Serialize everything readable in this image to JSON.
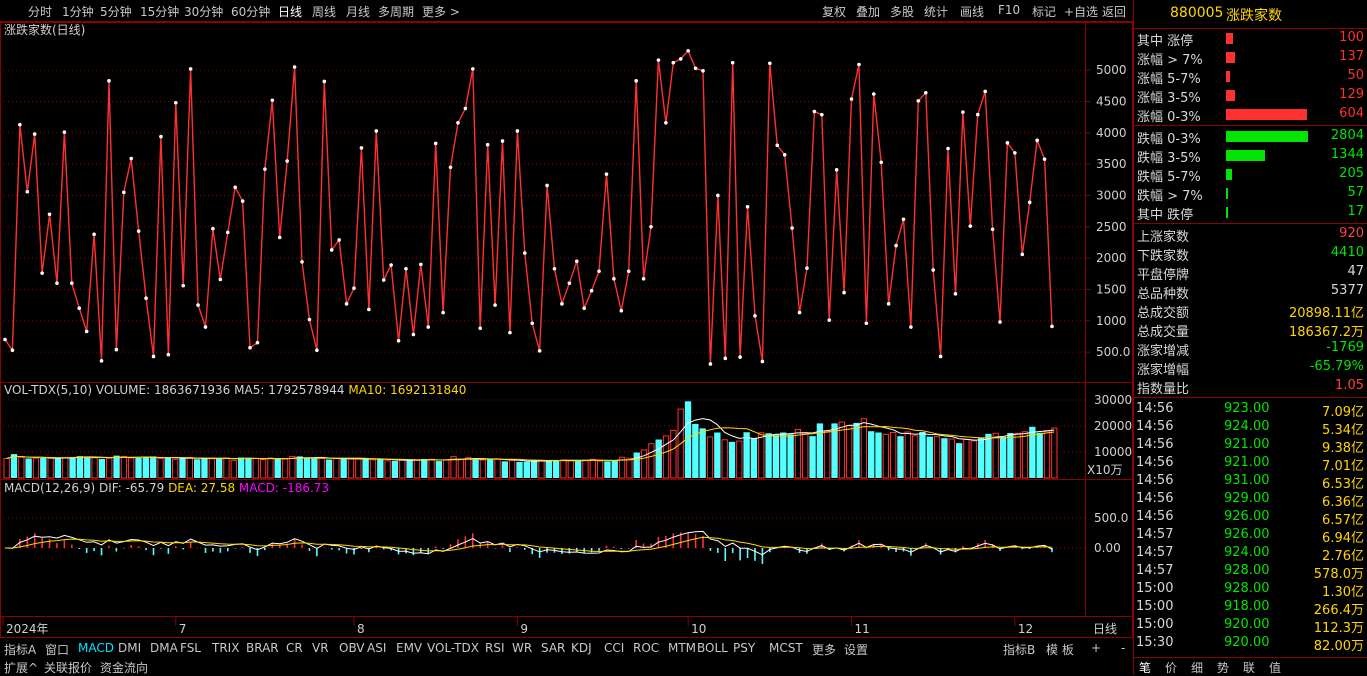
{
  "toolbar": {
    "periods": [
      "分时",
      "1分钟",
      "5分钟",
      "15分钟",
      "30分钟",
      "60分钟",
      "日线",
      "周线",
      "月线",
      "多周期",
      "更多"
    ],
    "active_period": "日线",
    "more_arrow": ">",
    "tools": [
      "复权",
      "叠加",
      "多股",
      "统计",
      "画线",
      "F10",
      "标记",
      "+自选",
      "返回"
    ]
  },
  "main_chart": {
    "title": "涨跌家数(日线)",
    "y_ticks": [
      "5000",
      "4500",
      "4000",
      "3500",
      "3000",
      "2500",
      "2000",
      "1500",
      "1000",
      "500.0"
    ],
    "line_color": "#ff3030"
  },
  "chart_data": [
    {
      "type": "line",
      "title": "涨跌家数(日线)",
      "ylim": [
        150,
        5450
      ],
      "series": [
        {
          "values": [
            700,
            530,
            4130,
            3060,
            3980,
            1760,
            2700,
            1600,
            4010,
            1600,
            1200,
            830,
            2380,
            360,
            4830,
            540,
            3050,
            3590,
            2430,
            1360,
            430,
            3940,
            460,
            4480,
            1560,
            5020,
            1250,
            900,
            2470,
            1660,
            2410,
            3130,
            2910,
            570,
            650,
            3420,
            4520,
            2330,
            3550,
            5050,
            1940,
            1020,
            530,
            4820,
            2130,
            2290,
            1270,
            1520,
            3760,
            1180,
            4030,
            1650,
            1890,
            680,
            1830,
            780,
            1900,
            900,
            3830,
            1130,
            3450,
            4160,
            4390,
            5020,
            880,
            3810,
            1250,
            3870,
            810,
            4030,
            2080,
            960,
            520,
            3160,
            1830,
            1270,
            1600,
            1950,
            1200,
            1480,
            1790,
            3340,
            1670,
            1160,
            1790,
            4830,
            1670,
            2500,
            5160,
            4160,
            5120,
            5180,
            5310,
            5030,
            4990,
            310,
            3000,
            400,
            5120,
            420,
            2820,
            1080,
            350,
            5110,
            3800,
            3650,
            2480,
            1130,
            1840,
            4340,
            4290,
            1010,
            3410,
            1450,
            4540,
            5090,
            960,
            4620,
            3530,
            1270,
            2200,
            2620,
            900,
            4510,
            4640,
            1810,
            430,
            3750,
            1430,
            4330,
            2510,
            4290,
            4660,
            2460,
            980,
            3840,
            3680,
            2060,
            2890,
            3880,
            3580,
            910
          ]
        }
      ]
    },
    {
      "type": "bar",
      "title": "VOL-TDX(5,10)",
      "ylabel": "X10万",
      "ylim": [
        0,
        30000
      ],
      "series": [
        {
          "name": "VOLUME",
          "value_label": "1863671936"
        },
        {
          "name": "MA5",
          "value_label": "1792578944"
        },
        {
          "name": "MA10",
          "value_label": "1692131840"
        }
      ],
      "values": [
        7500,
        9200,
        8000,
        7500,
        7600,
        7700,
        7600,
        7800,
        7700,
        8100,
        8400,
        8300,
        7800,
        7300,
        7600,
        8600,
        8300,
        7700,
        7700,
        8000,
        8300,
        7500,
        7900,
        7200,
        7600,
        7900,
        7200,
        7600,
        7400,
        7700,
        7700,
        6700,
        7900,
        7800,
        7500,
        7100,
        7600,
        7400,
        7300,
        8300,
        8300,
        7800,
        7600,
        7600,
        7100,
        7500,
        7600,
        7300,
        7300,
        7500,
        7000,
        7300,
        6600,
        6600,
        6900,
        7000,
        6900,
        7300,
        7200,
        6500,
        7000,
        8200,
        7200,
        7800,
        7300,
        6900,
        7500,
        7200,
        6400,
        6800,
        6200,
        6300,
        6700,
        6800,
        6700,
        6900,
        6900,
        6700,
        6900,
        6800,
        7200,
        6500,
        6400,
        6700,
        8000,
        7600,
        9800,
        10800,
        13200,
        14800,
        16200,
        18300,
        26500,
        29500,
        20800,
        19100,
        15800,
        17500,
        14700,
        13900,
        14200,
        17600,
        15300,
        17400,
        17200,
        16500,
        17500,
        16800,
        18700,
        17400,
        16100,
        21000,
        18000,
        21000,
        21500,
        20100,
        21200,
        22800,
        18000,
        17500,
        16800,
        17500,
        16100,
        17700,
        16200,
        17700,
        15900,
        15900,
        15300,
        15000,
        13400,
        14800,
        14300,
        15600,
        17000,
        17200,
        15800,
        17300,
        17200,
        17800,
        19700,
        17400,
        18300,
        19200
      ]
    },
    {
      "type": "bar",
      "title": "MACD(12,26,9)",
      "ylim": [
        -1100,
        850
      ],
      "series": [
        {
          "name": "DIF",
          "value_label": "-65.79"
        },
        {
          "name": "DEA",
          "value_label": "27.58"
        },
        {
          "name": "MACD",
          "value_label": "-186.73"
        }
      ]
    }
  ],
  "volume_chart": {
    "title": "VOL-TDX(5,10)",
    "vol_label": "VOLUME:",
    "vol_value": "1863671936",
    "ma5_label": "MA5:",
    "ma5_value": "1792578944",
    "ma10_label": "MA10:",
    "ma10_value": "1692131840",
    "y_ticks": [
      "30000",
      "20000",
      "10000"
    ],
    "unit": "X10万"
  },
  "macd_chart": {
    "title": "MACD(12,26,9)",
    "dif_label": "DIF:",
    "dif_value": "-65.79",
    "dea_label": "DEA:",
    "dea_value": "27.58",
    "macd_label": "MACD:",
    "macd_value": "-186.73",
    "y_ticks": [
      "500.0",
      "0.00"
    ]
  },
  "x_axis": {
    "labels": [
      "2024年",
      "7",
      "8",
      "9",
      "10",
      "11",
      "12"
    ],
    "right_label": "日线"
  },
  "indicator_tabs": [
    "指标A",
    "窗口",
    "MACD",
    "DMI",
    "DMA",
    "FSL",
    "TRIX",
    "BRAR",
    "CR",
    "VR",
    "OBV",
    "ASI",
    "EMV",
    "VOL-TDX",
    "RSI",
    "WR",
    "SAR",
    "KDJ",
    "CCI",
    "ROC",
    "MTM",
    "BOLL",
    "PSY",
    "MCST",
    "更多",
    "设置"
  ],
  "active_indicator": "MACD",
  "indicator_tabs_right": [
    "指标B",
    "模 板",
    "+",
    "-"
  ],
  "bottom_tabs": [
    "扩展^",
    "关联报价",
    "资金流向"
  ],
  "right_panel": {
    "code": "880005",
    "name": "涨跌家数",
    "up_rows": [
      {
        "label": "其中 涨停",
        "value": "100",
        "bar": 0.02
      },
      {
        "label": "涨幅 > 7%",
        "value": "137",
        "bar": 0.025
      },
      {
        "label": "涨幅 5-7%",
        "value": "50",
        "bar": 0.01
      },
      {
        "label": "涨幅 3-5%",
        "value": "129",
        "bar": 0.025
      },
      {
        "label": "涨幅 0-3%",
        "value": "604",
        "bar": 0.23
      }
    ],
    "down_rows": [
      {
        "label": "跌幅 0-3%",
        "value": "2804",
        "bar": 1.0
      },
      {
        "label": "跌幅 3-5%",
        "value": "1344",
        "bar": 0.48
      },
      {
        "label": "跌幅 5-7%",
        "value": "205",
        "bar": 0.07
      },
      {
        "label": "跌幅 > 7%",
        "value": "57",
        "bar": 0.015
      },
      {
        "label": "其中 跌停",
        "value": "17",
        "bar": 0.01
      }
    ],
    "stat_rows": [
      {
        "label": "上涨家数",
        "value": "920",
        "color": "#ff4040"
      },
      {
        "label": "下跌家数",
        "value": "4410",
        "color": "#00e600"
      },
      {
        "label": "平盘停牌",
        "value": "47",
        "color": "#d8d8d8"
      },
      {
        "label": "总品种数",
        "value": "5377",
        "color": "#d8d8d8"
      },
      {
        "label": "总成交额",
        "value": "20898.11亿",
        "color": "#ffd700"
      },
      {
        "label": "总成交量",
        "value": "186367.2万",
        "color": "#ffd700"
      },
      {
        "label": "涨家增减",
        "value": "-1769",
        "color": "#00e600"
      },
      {
        "label": "涨家增幅",
        "value": "-65.79%",
        "color": "#00e600"
      },
      {
        "label": "指数量比",
        "value": "1.05",
        "color": "#ff4040"
      }
    ],
    "ticks": [
      {
        "time": "14:56",
        "price": "923.00",
        "vol": "7.09亿"
      },
      {
        "time": "14:56",
        "price": "924.00",
        "vol": "5.34亿"
      },
      {
        "time": "14:56",
        "price": "921.00",
        "vol": "9.38亿"
      },
      {
        "time": "14:56",
        "price": "921.00",
        "vol": "7.01亿"
      },
      {
        "time": "14:56",
        "price": "931.00",
        "vol": "6.53亿"
      },
      {
        "time": "14:56",
        "price": "929.00",
        "vol": "6.36亿"
      },
      {
        "time": "14:56",
        "price": "926.00",
        "vol": "6.57亿"
      },
      {
        "time": "14:57",
        "price": "926.00",
        "vol": "6.94亿"
      },
      {
        "time": "14:57",
        "price": "924.00",
        "vol": "2.76亿"
      },
      {
        "time": "14:57",
        "price": "928.00",
        "vol": "578.0万"
      },
      {
        "time": "15:00",
        "price": "928.00",
        "vol": "1.30亿"
      },
      {
        "time": "15:00",
        "price": "918.00",
        "vol": "266.4万"
      },
      {
        "time": "15:00",
        "price": "920.00",
        "vol": "112.3万"
      },
      {
        "time": "15:30",
        "price": "920.00",
        "vol": "82.00万"
      }
    ],
    "bottom_tabs": [
      "笔",
      "价",
      "细",
      "势",
      "联",
      "值"
    ]
  },
  "colors": {
    "up": "#ff3030",
    "down": "#00e600",
    "cyan": "#54ffff",
    "grid": "#8b0000",
    "yellow": "#ffd700",
    "magenta": "#ff00ff"
  }
}
